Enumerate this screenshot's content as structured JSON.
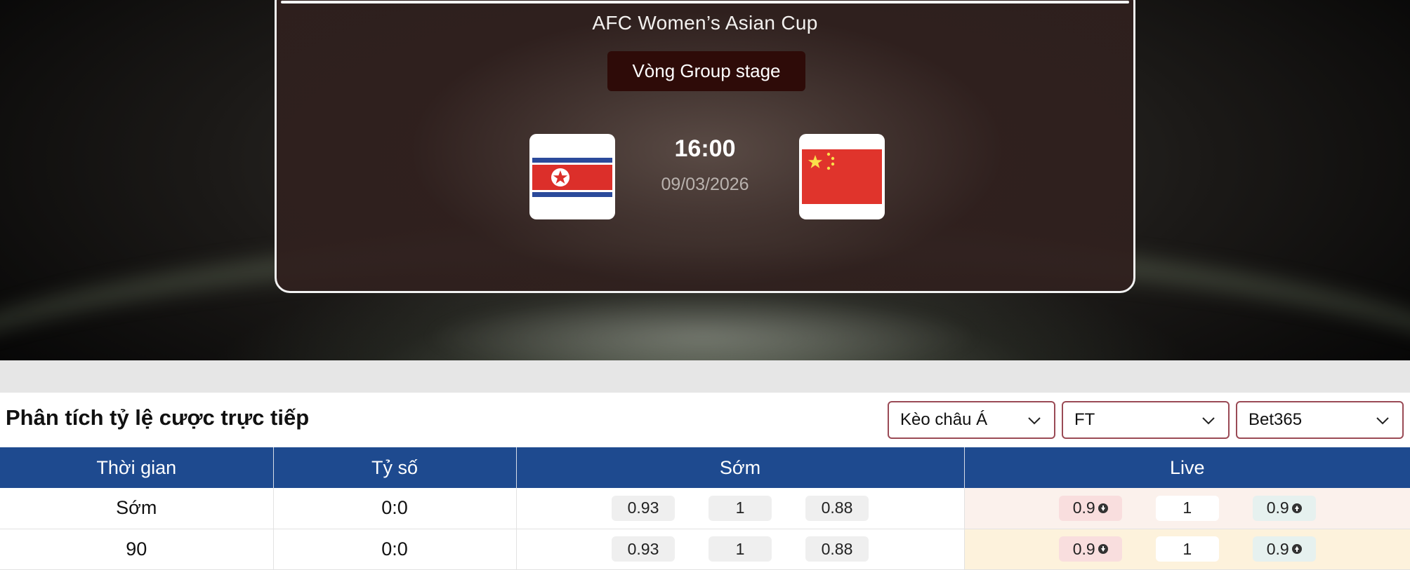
{
  "match": {
    "league": "AFC Women’s Asian Cup",
    "round": "Vòng Group stage",
    "time": "16:00",
    "date": "09/03/2026",
    "home_flag": "north-korea-flag",
    "away_flag": "china-flag"
  },
  "odds": {
    "title": "Phân tích tỷ lệ cược trực tiếp",
    "filters": {
      "market": "Kèo châu Á",
      "period": "FT",
      "bookmaker": "Bet365"
    },
    "headers": [
      "Thời gian",
      "Tỷ số",
      "Sớm",
      "Live"
    ],
    "rows": [
      {
        "time": "Sớm",
        "score": "0:0",
        "early": [
          "0.93",
          "1",
          "0.88"
        ],
        "live": [
          "0.9",
          "1",
          "0.9"
        ]
      },
      {
        "time": "90",
        "score": "0:0",
        "early": [
          "0.93",
          "1",
          "0.88"
        ],
        "live": [
          "0.9",
          "1",
          "0.9"
        ]
      }
    ]
  },
  "colors": {
    "header_blue": "#1e4a8f",
    "select_border": "#9a4a55",
    "odds_down": "#f9dede",
    "odds_up": "#e6f1ef"
  }
}
